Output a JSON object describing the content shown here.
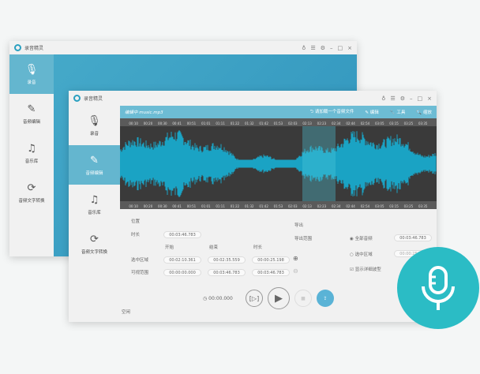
{
  "app": {
    "title": "录音精灵"
  },
  "sidebar": {
    "items": [
      {
        "label": "录音",
        "icon": "microphone-icon"
      },
      {
        "label": "音频编辑",
        "icon": "pencil-icon"
      },
      {
        "label": "音乐库",
        "icon": "music-list-icon"
      },
      {
        "label": "音频文字转换",
        "icon": "convert-icon"
      }
    ]
  },
  "toolbar": {
    "file": "编辑中 music.mp3",
    "load": "请加载一个音频文件",
    "edit": "编辑",
    "tools": "工具",
    "zoom": "缩放"
  },
  "ruler": [
    "00:10",
    "00:20",
    "00:30",
    "00:41",
    "00:51",
    "01:01",
    "01:11",
    "01:22",
    "01:32",
    "01:42",
    "01:53",
    "02:03",
    "02:13",
    "02:23",
    "02:34",
    "02:44",
    "02:54",
    "03:05",
    "03:15",
    "03:25",
    "03:35"
  ],
  "position": {
    "title": "位置",
    "duration_label": "时长",
    "duration": "00:03:46.783",
    "col_start": "开始",
    "col_end": "结束",
    "col_len": "时长",
    "sel_label": "选中区域",
    "sel_start": "00:02:10.361",
    "sel_end": "00:02:35.559",
    "sel_len": "00:00:25.198",
    "vis_label": "可视范围",
    "vis_start": "00:00:00.000",
    "vis_end": "00:03:46.783",
    "vis_len": "00:03:46.783"
  },
  "export": {
    "title": "导出",
    "range_label": "导出范围",
    "all": "全部音频",
    "all_value": "00:03:46.783",
    "selected": "选中区域",
    "selected_value": "00:00:25.198",
    "detail": "显示详细波型"
  },
  "player": {
    "time": "00:00.000",
    "status": "空闲"
  }
}
